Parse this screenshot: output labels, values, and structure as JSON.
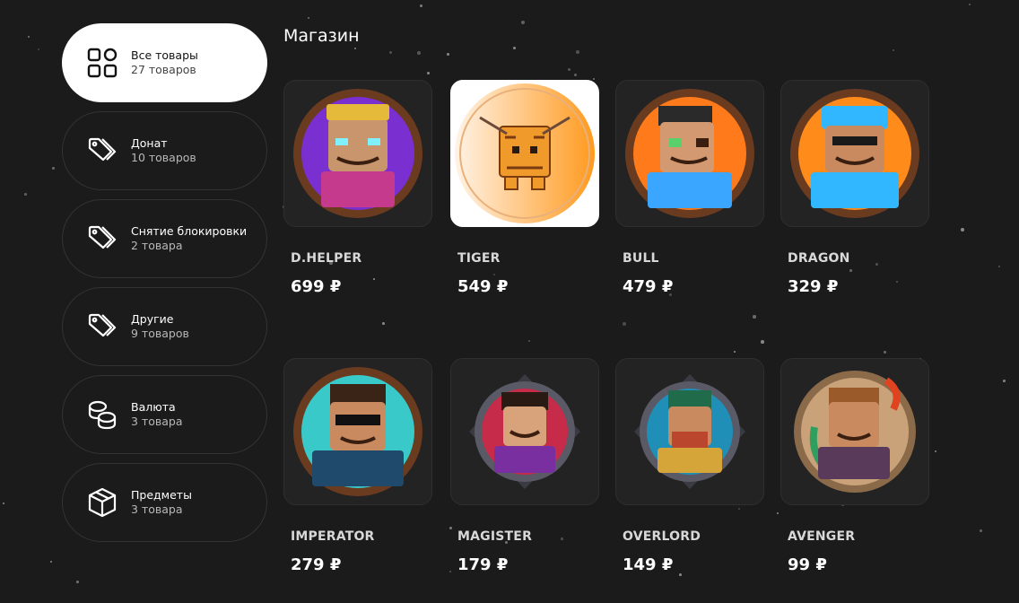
{
  "page": {
    "title": "Магазин"
  },
  "categories": [
    {
      "title": "Все товары",
      "count": "27 товаров",
      "icon": "grid-icon",
      "active": true
    },
    {
      "title": "Донат",
      "count": "10 товаров",
      "icon": "tags-icon"
    },
    {
      "title": "Снятие блокировки",
      "count": "2 товара",
      "icon": "tags-icon"
    },
    {
      "title": "Другие",
      "count": "9 товаров",
      "icon": "tags-icon"
    },
    {
      "title": "Валюта",
      "count": "3 товара",
      "icon": "coins-icon"
    },
    {
      "title": "Предметы",
      "count": "3 товара",
      "icon": "box-icon"
    }
  ],
  "products": [
    {
      "name": "D.HELPER",
      "price": "699 ₽",
      "colors": [
        "#7a2fd1",
        "#c63a8e"
      ]
    },
    {
      "name": "TIGER",
      "price": "549 ₽",
      "colors": [
        "#ff9a1f",
        "#ffd9a8"
      ]
    },
    {
      "name": "BULL",
      "price": "479 ₽",
      "colors": [
        "#ff7a1a",
        "#3aa6ff"
      ]
    },
    {
      "name": "DRAGON",
      "price": "329 ₽",
      "colors": [
        "#ff8c1a",
        "#31b7ff"
      ]
    },
    {
      "name": "IMPERATOR",
      "price": "279 ₽",
      "colors": [
        "#39c9c9",
        "#1f4a6b"
      ]
    },
    {
      "name": "MAGISTER",
      "price": "179 ₽",
      "colors": [
        "#c62b4a",
        "#2a6fe0"
      ]
    },
    {
      "name": "OVERLORD",
      "price": "149 ₽",
      "colors": [
        "#1f8fb8",
        "#b9462d"
      ]
    },
    {
      "name": "AVENGER",
      "price": "99 ₽",
      "colors": [
        "#2f9e5f",
        "#e0431f"
      ]
    }
  ]
}
